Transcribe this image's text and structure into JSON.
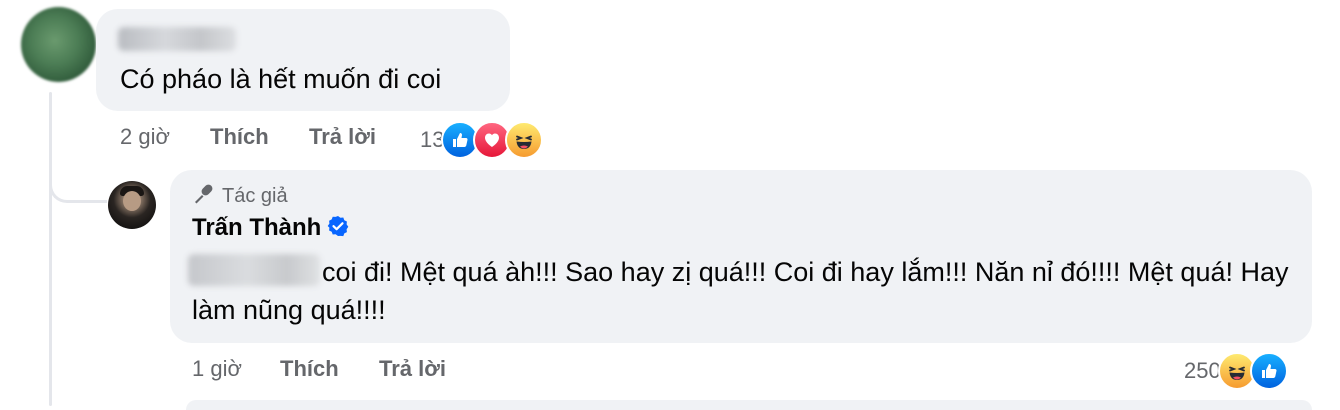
{
  "comment1": {
    "text": "Có pháo là hết muốn đi coi",
    "time": "2 giờ",
    "like_label": "Thích",
    "reply_label": "Trả lời",
    "reaction_count": "13",
    "reactions": [
      "like-icon",
      "love-icon",
      "haha-icon"
    ]
  },
  "reply": {
    "badge": "Tác giả",
    "author": "Trấn Thành",
    "text": "coi đi! Mệt quá àh!!! Sao hay zị quá!!! Coi đi hay lắm!!! Năn nỉ đó!!!! Mệt quá! Hay làm nũng quá!!!!",
    "time": "1 giờ",
    "like_label": "Thích",
    "reply_label": "Trả lời",
    "reaction_count": "250",
    "reactions": [
      "haha-icon",
      "like-icon"
    ]
  },
  "colors": {
    "bubble": "#f0f2f5",
    "meta_text": "#65676b",
    "verified": "#0866ff"
  }
}
